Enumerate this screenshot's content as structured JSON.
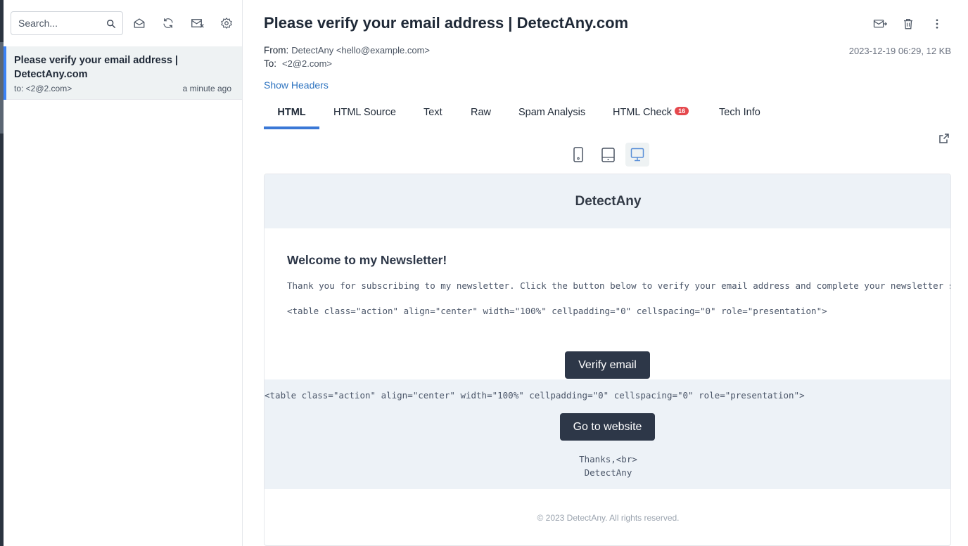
{
  "sidebar": {
    "search": {
      "placeholder": "Search...",
      "value": ""
    },
    "tool_icons": [
      "mail-open-icon",
      "refresh-icon",
      "mail-off-icon",
      "gear-icon"
    ],
    "messages": [
      {
        "subject": "Please verify your email address | DetectAny.com",
        "to": "to: <2@2.com>",
        "time": "a minute ago",
        "selected": true
      }
    ]
  },
  "message": {
    "title": "Please verify your email address | DetectAny.com",
    "from_label": "From:",
    "from_value": "DetectAny <hello@example.com>",
    "to_label": "To:",
    "to_value": "<2@2.com>",
    "date_size": "2023-12-19 06:29, 12 KB",
    "show_headers": "Show Headers",
    "actions": [
      "forward-mail-icon",
      "trash-icon",
      "more-vertical-icon"
    ]
  },
  "tabs": [
    {
      "label": "HTML",
      "active": true
    },
    {
      "label": "HTML Source",
      "active": false
    },
    {
      "label": "Text",
      "active": false
    },
    {
      "label": "Raw",
      "active": false
    },
    {
      "label": "Spam Analysis",
      "active": false
    },
    {
      "label": "HTML Check",
      "active": false,
      "badge": "16"
    },
    {
      "label": "Tech Info",
      "active": false
    }
  ],
  "device_toggles": [
    {
      "icon": "phone-icon",
      "active": false
    },
    {
      "icon": "tablet-icon",
      "active": false
    },
    {
      "icon": "desktop-icon",
      "active": true
    }
  ],
  "preview": {
    "brand": "DetectAny",
    "heading": "Welcome to my Newsletter!",
    "paragraph": "Thank you for subscribing to my newsletter. Click the button below to verify your email address and complete your newsletter subscription.",
    "raw_table_1": "<table class=\"action\" align=\"center\" width=\"100%\" cellpadding=\"0\" cellspacing=\"0\" role=\"presentation\">",
    "verify_button": "Verify email",
    "raw_table_2": "<table class=\"action\" align=\"center\" width=\"100%\" cellpadding=\"0\" cellspacing=\"0\" role=\"presentation\">",
    "website_button": "Go to website",
    "thanks_line1": "Thanks,<br>",
    "thanks_line2": "DetectAny",
    "footer": "© 2023 DetectAny. All rights reserved."
  },
  "colors": {
    "accent": "#3a78d6",
    "badge": "#e5484d",
    "button_dark": "#2d3748",
    "link": "#2f74c0"
  }
}
